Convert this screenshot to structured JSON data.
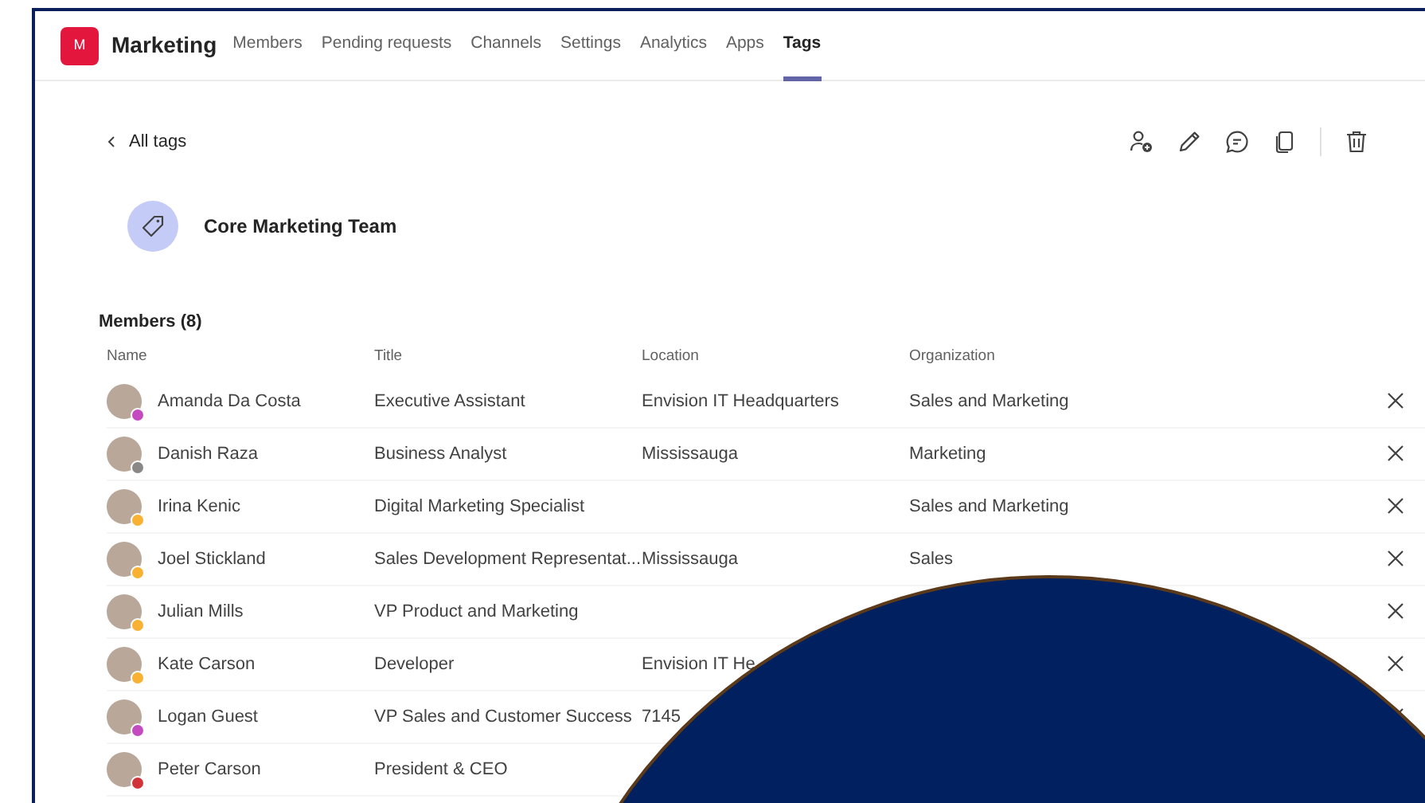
{
  "team": {
    "initial": "M",
    "name": "Marketing"
  },
  "tabs": [
    {
      "label": "Members",
      "selected": false
    },
    {
      "label": "Pending requests",
      "selected": false
    },
    {
      "label": "Channels",
      "selected": false
    },
    {
      "label": "Settings",
      "selected": false
    },
    {
      "label": "Analytics",
      "selected": false
    },
    {
      "label": "Apps",
      "selected": false
    },
    {
      "label": "Tags",
      "selected": true
    }
  ],
  "back_link": "All tags",
  "tag": {
    "name": "Core Marketing Team"
  },
  "members_heading": "Members (8)",
  "table": {
    "columns": [
      "Name",
      "Title",
      "Location",
      "Organization"
    ],
    "rows": [
      {
        "name": "Amanda Da Costa",
        "title": "Executive Assistant",
        "location": "Envision IT Headquarters",
        "organization": "Sales and Marketing",
        "color": "#c34bbf"
      },
      {
        "name": "Danish Raza",
        "title": "Business Analyst",
        "location": "Mississauga",
        "organization": "Marketing",
        "color": "#8a8886"
      },
      {
        "name": "Irina Kenic",
        "title": "Digital Marketing Specialist",
        "organization": "Sales and Marketing",
        "color": "#f8b133"
      },
      {
        "name": "Joel Stickland",
        "title": "Sales Development Representat...",
        "location": "Mississauga",
        "organization": "Sales",
        "color": "#f8b133"
      },
      {
        "name": "Julian Mills",
        "title": "VP Product and Marketing",
        "color": "#f8b133"
      },
      {
        "name": "Kate Carson",
        "title": "Developer",
        "location": "Envision IT He",
        "color": "#f8b133"
      },
      {
        "name": "Logan Guest",
        "title": "VP Sales and Customer Success",
        "location": "7145",
        "color": "#c34bbf"
      },
      {
        "name": "Peter Carson",
        "title": "President & CEO",
        "color": "#d13438"
      }
    ]
  }
}
